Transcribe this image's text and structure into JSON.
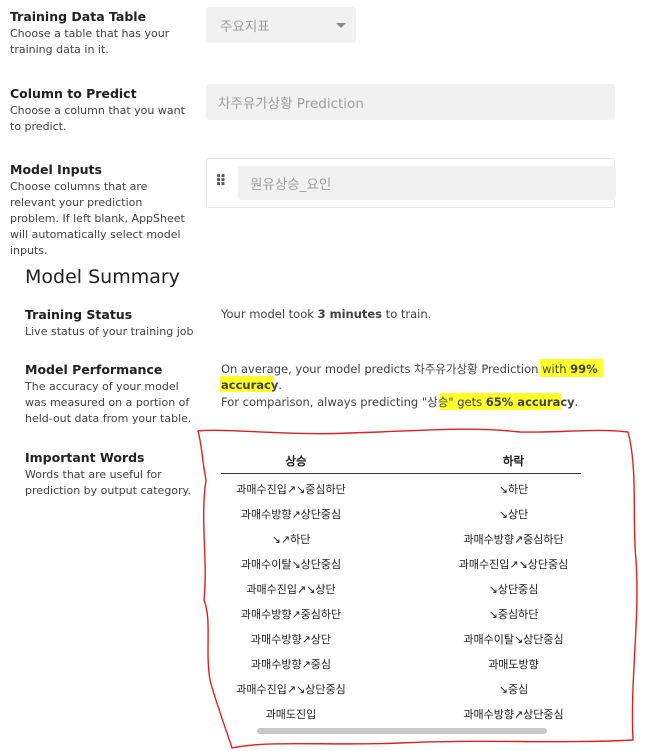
{
  "training_table": {
    "title": "Training Data Table",
    "description": "Choose a table that has your training data in it.",
    "value": "주요지표"
  },
  "column_predict": {
    "title": "Column to Predict",
    "description": "Choose a column that you want to predict.",
    "value": "차주유가상황 Prediction"
  },
  "model_inputs": {
    "title": "Model Inputs",
    "description": "Choose columns that are relevant your prediction problem. If left blank, AppSheet will automatically select model inputs.",
    "value": "원유상승_요인"
  },
  "summary": {
    "title": "Model Summary",
    "training_status": {
      "title": "Training Status",
      "description": "Live status of your training job",
      "text_before": "Your model took ",
      "text_bold": "3 minutes",
      "text_after": " to train."
    },
    "performance": {
      "title": "Model Performance",
      "description": "The accuracy of your model was measured on a portion of held-out data from your table.",
      "line1_before": "On average, your model predicts 차주유가상황 Prediction with ",
      "line1_bold": "99% accuracy",
      "line1_after": ".",
      "line2_before": "For comparison, always predicting \"상승\" gets ",
      "line2_bold": "65% accuracy",
      "line2_after": "."
    },
    "important_words": {
      "title": "Important Words",
      "description": "Words that are useful for prediction by output category.",
      "columns": [
        "상승",
        "하락"
      ],
      "rows": [
        [
          "과매수진입↗↘중심하단",
          "↘하단"
        ],
        [
          "과매수방향↗상단중심",
          "↘상단"
        ],
        [
          "↘↗하단",
          "과매수방향↗중심하단"
        ],
        [
          "과매수이탈↘상단중심",
          "과매수진입↗↘상단중심"
        ],
        [
          "과매수진입↗↘상단",
          "↘상단중심"
        ],
        [
          "과매수방향↗중심하단",
          "↘중심하단"
        ],
        [
          "과매수방향↗상단",
          "과매수이탈↘상단중심"
        ],
        [
          "과매수방향↗중심",
          "과매도방향"
        ],
        [
          "과매수진입↗↘상단중심",
          "↘중심"
        ],
        [
          "과매도진입",
          "과매수방향↗상단중심"
        ]
      ]
    }
  },
  "colors": {
    "highlight": "#ffff2b",
    "annotation": "#e02020"
  }
}
